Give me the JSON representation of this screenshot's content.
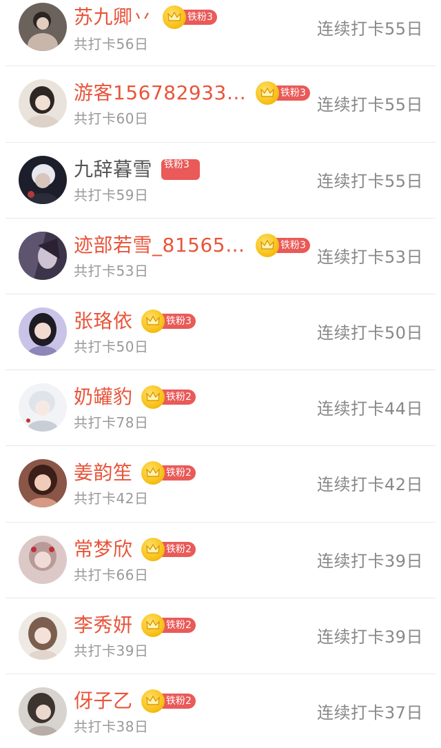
{
  "colors": {
    "name_highlight": "#e8543a",
    "name_plain": "#555555",
    "badge": "#e95a58",
    "crown": "#f8c21a",
    "muted_text": "#999999",
    "streak_text": "#888888"
  },
  "rows": [
    {
      "name": "苏九卿丷",
      "badge": "铁粉3",
      "badge_style": "crown",
      "total": "共打卡56日",
      "streak": "连续打卡55日"
    },
    {
      "name": "游客156782933…",
      "badge": "铁粉3",
      "badge_style": "crown",
      "total": "共打卡60日",
      "streak": "连续打卡55日"
    },
    {
      "name": "九辞暮雪",
      "badge": "铁粉3",
      "badge_style": "plain",
      "total": "共打卡59日",
      "streak": "连续打卡55日"
    },
    {
      "name": "迹部若雪_81565…",
      "badge": "铁粉3",
      "badge_style": "crown",
      "total": "共打卡53日",
      "streak": "连续打卡53日"
    },
    {
      "name": "张珞依",
      "badge": "铁粉3",
      "badge_style": "crown",
      "total": "共打卡50日",
      "streak": "连续打卡50日"
    },
    {
      "name": "奶罐豹",
      "badge": "铁粉2",
      "badge_style": "crown",
      "total": "共打卡78日",
      "streak": "连续打卡44日"
    },
    {
      "name": "姜韵笙",
      "badge": "铁粉2",
      "badge_style": "crown",
      "total": "共打卡42日",
      "streak": "连续打卡42日"
    },
    {
      "name": "常梦欣",
      "badge": "铁粉2",
      "badge_style": "crown",
      "total": "共打卡66日",
      "streak": "连续打卡39日"
    },
    {
      "name": "李秀妍",
      "badge": "铁粉2",
      "badge_style": "crown",
      "total": "共打卡39日",
      "streak": "连续打卡39日"
    },
    {
      "name": "伢子乙",
      "badge": "铁粉2",
      "badge_style": "crown",
      "total": "共打卡38日",
      "streak": "连续打卡37日"
    }
  ]
}
